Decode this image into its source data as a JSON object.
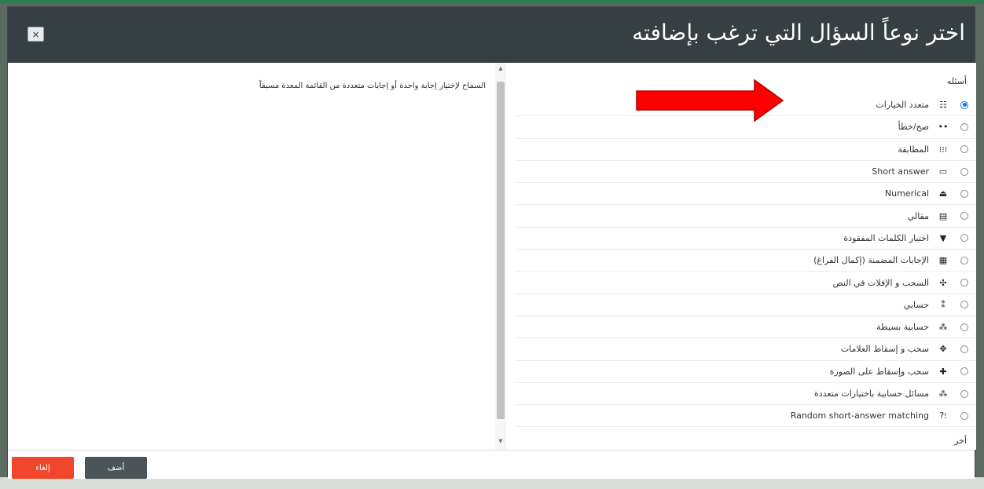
{
  "dialog": {
    "title": "اختر نوعاً السؤال التي ترغب بإضافته",
    "close_label": "×"
  },
  "description": "السماح لإختيار إجابة واحدة أو إجابات متعددة من القائمة المعدة مسبقاً",
  "groups": {
    "questions_title": "أسئله",
    "other_title": "أخر"
  },
  "options": [
    {
      "label": "متعدد الخيارات",
      "icon": "☷",
      "icon_name": "multiple-choice-icon",
      "selected": true
    },
    {
      "label": "صح/خطأ",
      "icon": "••",
      "icon_name": "true-false-icon",
      "selected": false
    },
    {
      "label": "المطابقة",
      "icon": "⁝⁝⁝",
      "icon_name": "matching-icon",
      "selected": false
    },
    {
      "label": "Short answer",
      "icon": "▭",
      "icon_name": "short-answer-icon",
      "selected": false
    },
    {
      "label": "Numerical",
      "icon": "⏏",
      "icon_name": "numerical-icon",
      "selected": false
    },
    {
      "label": "مقالي",
      "icon": "▤",
      "icon_name": "essay-icon",
      "selected": false
    },
    {
      "label": "اختيار الكلمات المفقودة",
      "icon": "▼",
      "icon_name": "select-missing-words-icon",
      "selected": false
    },
    {
      "label": "الإجابات المضمنة (إكمال الفراغ)",
      "icon": "▦",
      "icon_name": "embedded-answers-icon",
      "selected": false
    },
    {
      "label": "السحب و الإفلات في النص",
      "icon": "✣",
      "icon_name": "drag-drop-text-icon",
      "selected": false
    },
    {
      "label": "حسابي",
      "icon": "⁑",
      "icon_name": "calculated-icon",
      "selected": false
    },
    {
      "label": "حسابية بسيطة",
      "icon": "⁂",
      "icon_name": "simple-calculated-icon",
      "selected": false
    },
    {
      "label": "سحب و إسقاط العلامات",
      "icon": "✥",
      "icon_name": "drag-drop-markers-icon",
      "selected": false
    },
    {
      "label": "سحب وإسقاط على الصورة",
      "icon": "✚",
      "icon_name": "drag-drop-image-icon",
      "selected": false
    },
    {
      "label": "مسائل حسابية باختيارات متعددة",
      "icon": "⁂",
      "icon_name": "calculated-multichoice-icon",
      "selected": false
    },
    {
      "label": "Random short-answer matching",
      "icon": "⁝?",
      "icon_name": "random-matching-icon",
      "selected": false
    }
  ],
  "footer": {
    "add_label": "أضف",
    "cancel_label": "إلغاء"
  },
  "colors": {
    "header_bg": "#363f43",
    "cancel_bg": "#f0462c",
    "add_bg": "#4b5559",
    "radio_selected": "#1a73e8",
    "arrow": "#ff0000"
  }
}
